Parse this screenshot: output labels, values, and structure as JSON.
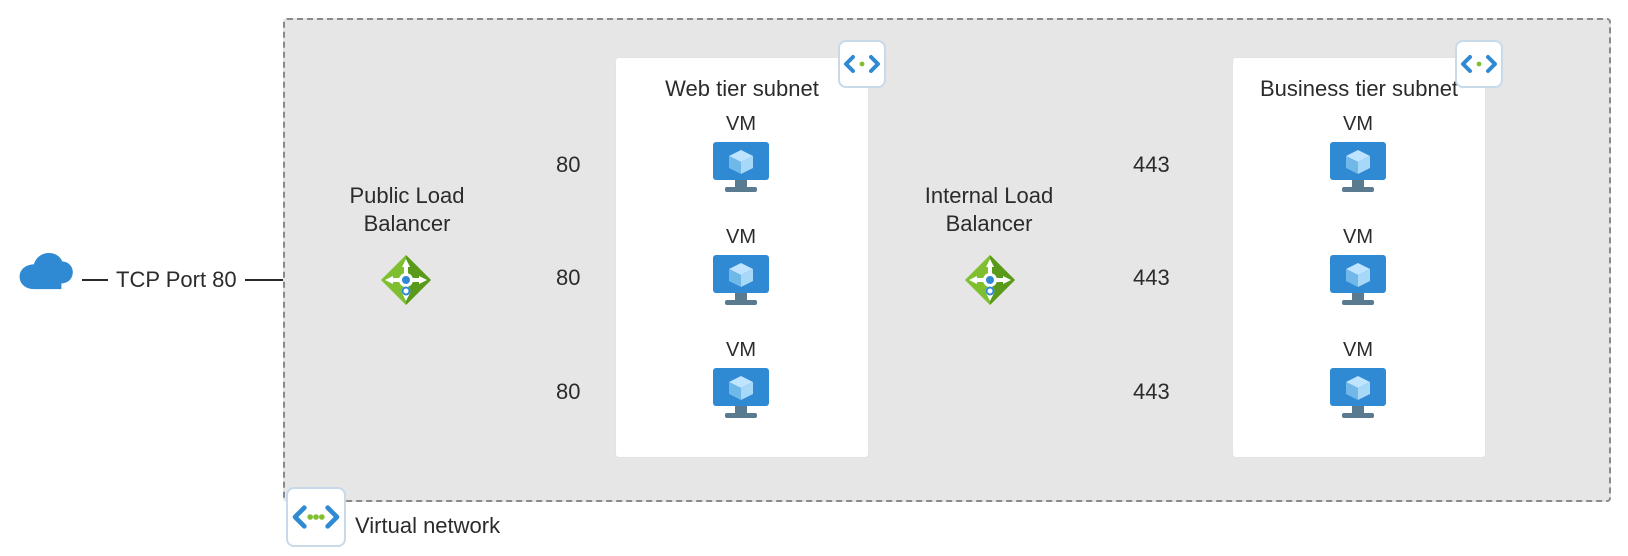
{
  "ingress": {
    "label": "TCP Port 80"
  },
  "vnet": {
    "label": "Virtual network"
  },
  "loadBalancers": {
    "public": {
      "label": "Public Load\nBalancer"
    },
    "internal": {
      "label": "Internal Load\nBalancer"
    }
  },
  "subnets": {
    "web": {
      "title": "Web tier subnet",
      "vms": [
        {
          "label": "VM",
          "port": "80"
        },
        {
          "label": "VM",
          "port": "80"
        },
        {
          "label": "VM",
          "port": "80"
        }
      ]
    },
    "business": {
      "title": "Business tier subnet",
      "vms": [
        {
          "label": "VM",
          "port": "443"
        },
        {
          "label": "VM",
          "port": "443"
        },
        {
          "label": "VM",
          "port": "443"
        }
      ]
    }
  },
  "icons": {
    "cloud": "cloud-icon",
    "vnet": "vnet-icon",
    "subnet": "subnet-icon",
    "loadBalancer": "load-balancer-icon",
    "vm": "vm-icon"
  },
  "colors": {
    "azureBlue": "#2f8ad3",
    "azureBlueLight": "#5aa8e6",
    "lbGreen": "#7fbf2f",
    "lbGreenDark": "#5a9a1a",
    "frameGray": "#8a8a8a",
    "bgGray": "#e6e6e6"
  }
}
